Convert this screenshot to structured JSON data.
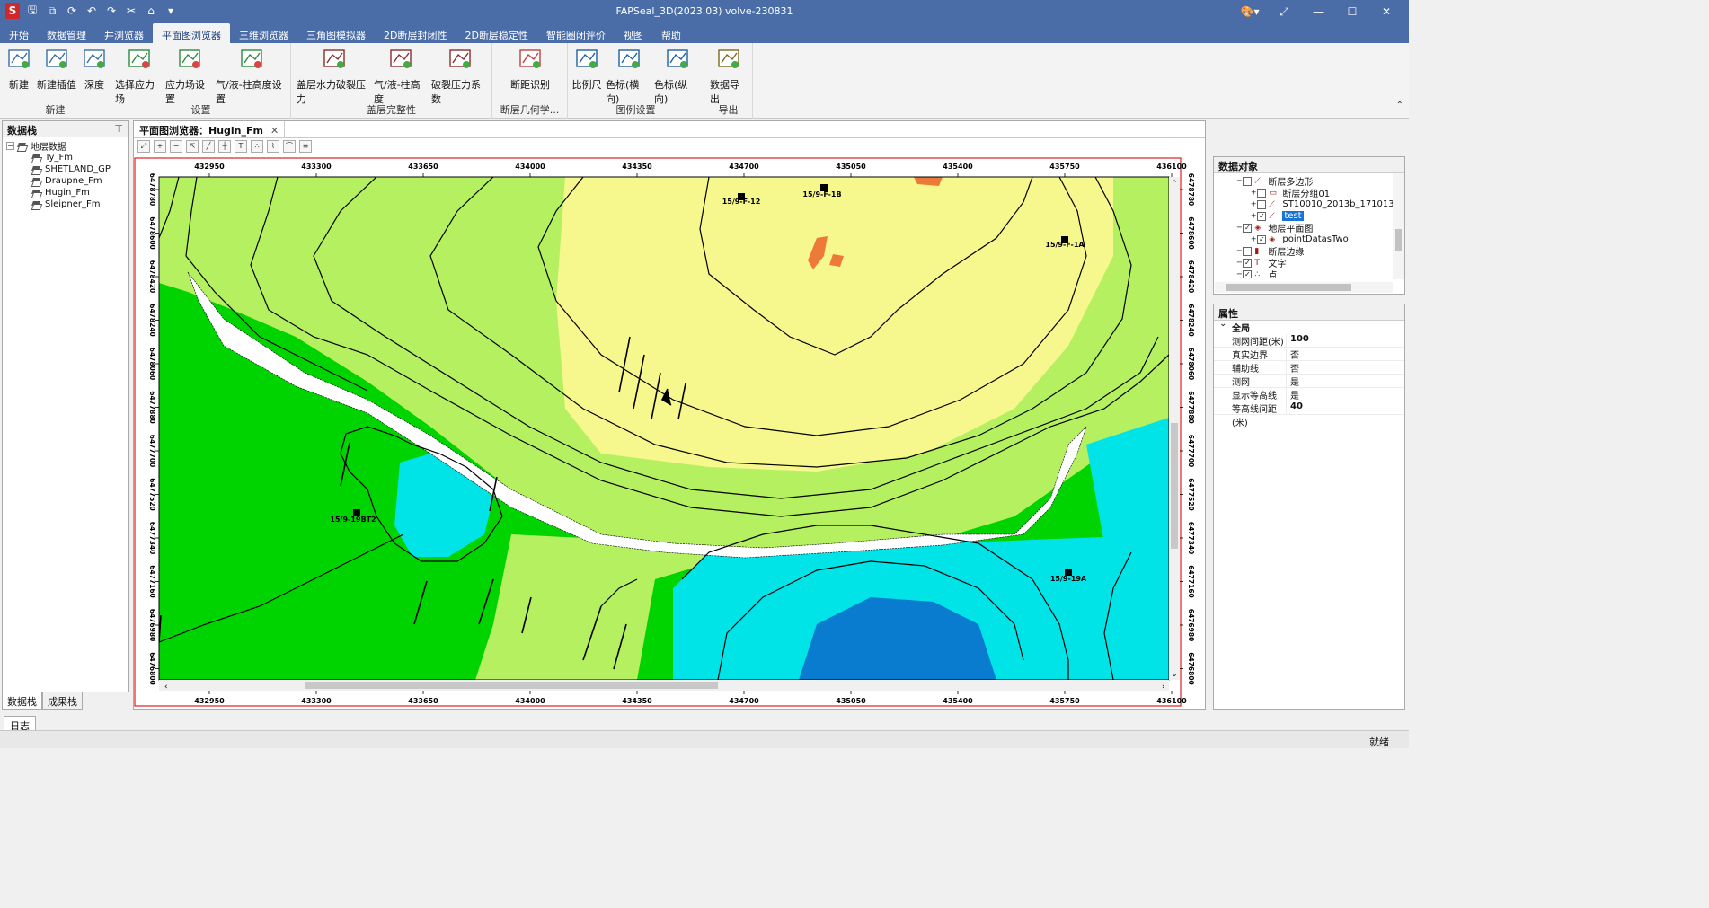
{
  "app": {
    "title": "FAPSeal_3D(2023.03) volve-230831"
  },
  "menu": [
    "开始",
    "数据管理",
    "井浏览器",
    "平面图浏览器",
    "三维浏览器",
    "三角图模拟器",
    "2D断层封闭性",
    "2D断层稳定性",
    "智能圈闭评价",
    "视图",
    "帮助"
  ],
  "menu_active": "平面图浏览器",
  "ribbon": {
    "groups": [
      {
        "name": "新建",
        "buttons": [
          "新建",
          "新建插值",
          "深度"
        ]
      },
      {
        "name": "设置",
        "buttons": [
          "选择应力场",
          "应力场设置",
          "气/液-柱高度设置"
        ]
      },
      {
        "name": "盖层完整性",
        "buttons": [
          "盖层水力破裂压力",
          "气/液-柱高度",
          "破裂压力系数"
        ]
      },
      {
        "name": "断层几何学...",
        "buttons": [
          "断距识别"
        ]
      },
      {
        "name": "图例设置",
        "buttons": [
          "比例尺",
          "色标(横向)",
          "色标(纵向)"
        ]
      },
      {
        "name": "导出",
        "buttons": [
          "数据导出"
        ]
      }
    ]
  },
  "left_panel": {
    "title": "数据栈",
    "root": "地层数据",
    "items": [
      "Ty_Fm",
      "SHETLAND_GP",
      "Draupne_Fm",
      "Hugin_Fm",
      "Sleipner_Fm"
    ],
    "tabs": [
      "数据栈",
      "成果栈"
    ]
  },
  "document": {
    "tab_label": "平面图浏览器：Hugin_Fm",
    "x_ticks": [
      "432950",
      "433300",
      "433650",
      "434000",
      "434350",
      "434700",
      "435050",
      "435400",
      "435750",
      "436100"
    ],
    "y_ticks": [
      "6478780",
      "6478600",
      "6478420",
      "6478240",
      "6478060",
      "6477880",
      "6477700",
      "6477520",
      "6477340",
      "6477160",
      "6476980",
      "6476800"
    ],
    "wells": [
      "15/9-F-12",
      "15/9-F-1B",
      "15/9-F-1A",
      "15/9-19BT2",
      "15/9-19A"
    ],
    "toolbar_icons": [
      "zoom-extent-icon",
      "zoom-in-icon",
      "zoom-out-icon",
      "pan-icon",
      "ruler-icon",
      "crosshair-icon",
      "text-tool-icon",
      "points-icon",
      "line-icon",
      "polyline-icon",
      "layers-icon"
    ]
  },
  "data_objects": {
    "title": "数据对象",
    "rows": [
      {
        "label": "断层多边形",
        "indent": 1,
        "checked": false
      },
      {
        "label": "断层分组01",
        "indent": 2,
        "checked": false
      },
      {
        "label": "ST10010_2013b_171013_",
        "indent": 2,
        "checked": false
      },
      {
        "label": "test",
        "indent": 2,
        "checked": true,
        "selected": true
      },
      {
        "label": "地层平面图",
        "indent": 1,
        "checked": true
      },
      {
        "label": "pointDatasTwo",
        "indent": 2,
        "checked": true
      },
      {
        "label": "断层边缘",
        "indent": 1,
        "checked": false
      },
      {
        "label": "文字",
        "indent": 1,
        "checked": true
      },
      {
        "label": "点",
        "indent": 1,
        "checked": true
      }
    ]
  },
  "properties": {
    "title": "属性",
    "section": "全局",
    "rows": [
      {
        "key": "测网间距(米)",
        "value": "100"
      },
      {
        "key": "真实边界",
        "value": "否"
      },
      {
        "key": "辅助线",
        "value": "否"
      },
      {
        "key": "测网",
        "value": "是"
      },
      {
        "key": "显示等高线",
        "value": "是"
      },
      {
        "key": "等高线间距(米)",
        "value": "40"
      }
    ]
  },
  "bottom": {
    "log_tab": "日志",
    "status": "就绪"
  },
  "colors": {
    "titlebar": "#4a6da7",
    "green": "#00d400",
    "lightgreen": "#b4f060",
    "yellow": "#f6f78c",
    "cyan": "#00e4e8",
    "blue": "#0a7cd0",
    "orange": "#ee7a3a"
  }
}
